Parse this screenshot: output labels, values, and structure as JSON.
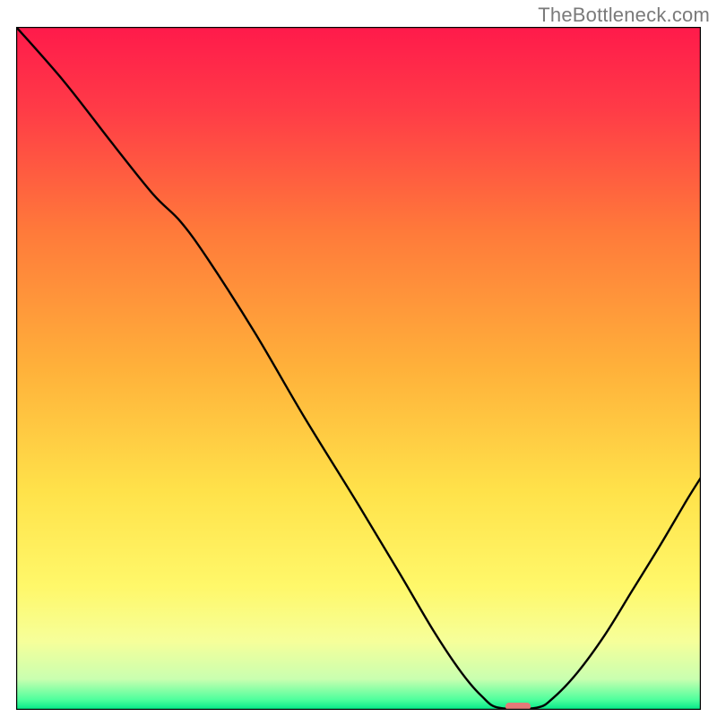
{
  "attribution": "TheBottleneck.com",
  "chart_data": {
    "type": "line",
    "title": "",
    "xlabel": "",
    "ylabel": "",
    "xlim": [
      0,
      100
    ],
    "ylim": [
      0,
      100
    ],
    "background": {
      "type": "vertical-gradient",
      "stops": [
        {
          "pos": 0.0,
          "color": "#ff1a4b"
        },
        {
          "pos": 0.12,
          "color": "#ff3b47"
        },
        {
          "pos": 0.3,
          "color": "#ff7a3a"
        },
        {
          "pos": 0.5,
          "color": "#ffb13a"
        },
        {
          "pos": 0.68,
          "color": "#ffe24a"
        },
        {
          "pos": 0.82,
          "color": "#fff86a"
        },
        {
          "pos": 0.9,
          "color": "#f6ff9a"
        },
        {
          "pos": 0.955,
          "color": "#c9ffb0"
        },
        {
          "pos": 0.985,
          "color": "#4fff9d"
        },
        {
          "pos": 1.0,
          "color": "#00e887"
        }
      ]
    },
    "series": [
      {
        "name": "curve",
        "color": "#000000",
        "stroke_width": 2.4,
        "points": [
          {
            "x": 0.0,
            "y": 100.0
          },
          {
            "x": 7.0,
            "y": 92.0
          },
          {
            "x": 14.0,
            "y": 83.0
          },
          {
            "x": 20.0,
            "y": 75.5
          },
          {
            "x": 24.0,
            "y": 71.5
          },
          {
            "x": 28.0,
            "y": 66.0
          },
          {
            "x": 35.0,
            "y": 55.0
          },
          {
            "x": 42.0,
            "y": 43.0
          },
          {
            "x": 50.0,
            "y": 30.0
          },
          {
            "x": 56.0,
            "y": 20.0
          },
          {
            "x": 61.0,
            "y": 11.5
          },
          {
            "x": 65.0,
            "y": 5.5
          },
          {
            "x": 68.0,
            "y": 2.0
          },
          {
            "x": 70.5,
            "y": 0.3
          },
          {
            "x": 76.0,
            "y": 0.3
          },
          {
            "x": 78.5,
            "y": 1.8
          },
          {
            "x": 82.0,
            "y": 5.5
          },
          {
            "x": 86.0,
            "y": 11.0
          },
          {
            "x": 90.0,
            "y": 17.5
          },
          {
            "x": 94.0,
            "y": 24.0
          },
          {
            "x": 98.0,
            "y": 30.8
          },
          {
            "x": 100.0,
            "y": 34.0
          }
        ]
      }
    ],
    "marker": {
      "name": "highlight-pill",
      "x": 73.3,
      "y": 0.5,
      "width_pct": 3.7,
      "height_pct": 1.1,
      "color": "#e47a78"
    },
    "axes": {
      "show_frame": true,
      "frame_color": "#000000",
      "frame_width": 2.4,
      "ticks": false,
      "grid": false
    }
  }
}
